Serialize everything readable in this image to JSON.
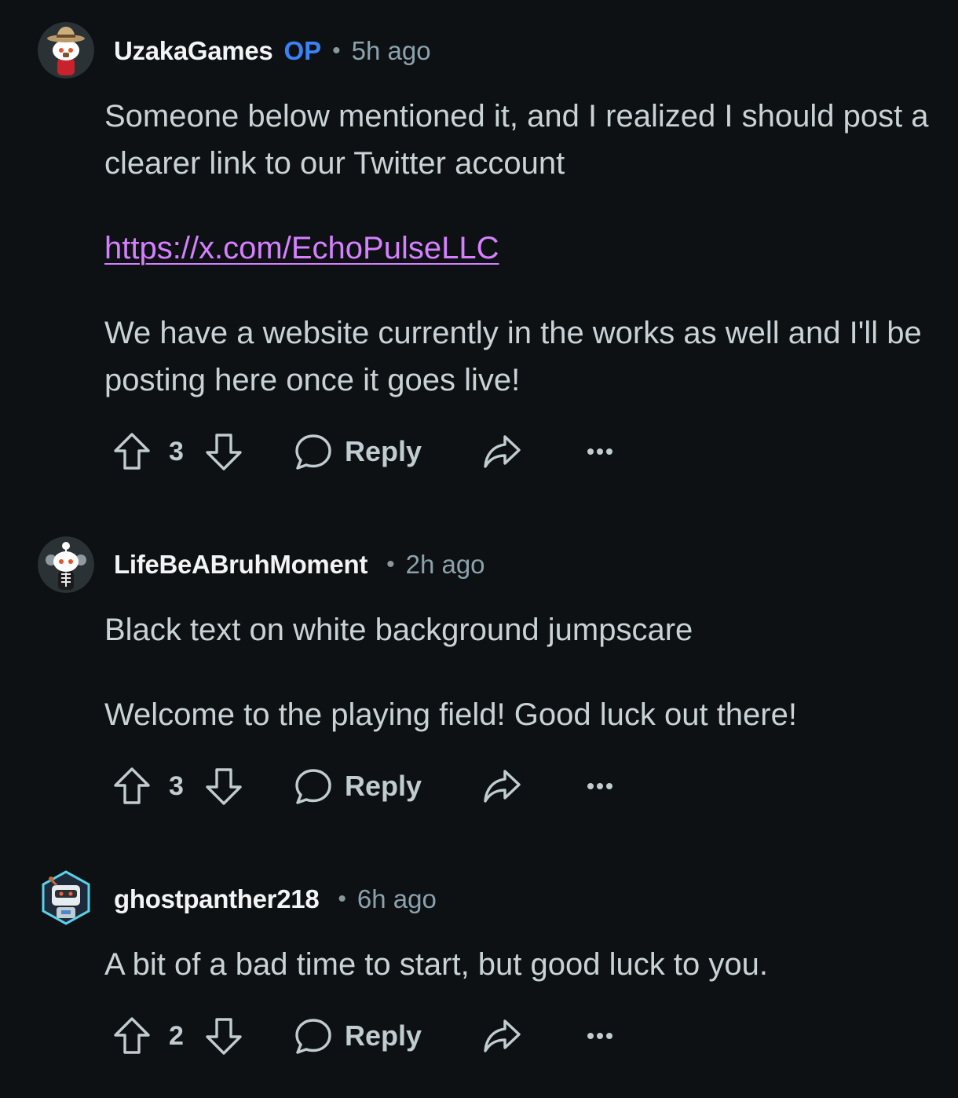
{
  "comments": [
    {
      "username": "UzakaGames",
      "op_badge": "OP",
      "separator": "•",
      "time": "5h ago",
      "paragraphs": [
        "Someone below mentioned it, and I realized I should post a clearer link to our Twitter account",
        "We have a website currently in the works as well and I'll be posting here once it goes live!"
      ],
      "link": "https://x.com/EchoPulseLLC",
      "votes": "3",
      "reply_label": "Reply"
    },
    {
      "username": "LifeBeABruhMoment",
      "separator": "•",
      "time": "2h ago",
      "paragraphs": [
        "Black text on white background jumpscare",
        "Welcome to the playing field! Good luck out there!"
      ],
      "votes": "3",
      "reply_label": "Reply"
    },
    {
      "username": "ghostpanther218",
      "separator": "•",
      "time": "6h ago",
      "paragraphs": [
        "A bit of a bad time to start, but good luck to you."
      ],
      "votes": "2",
      "reply_label": "Reply"
    }
  ],
  "icons": {
    "upvote": "upvote-arrow-icon",
    "downvote": "downvote-arrow-icon",
    "reply": "speech-bubble-icon",
    "share": "share-arrow-icon",
    "more": "ellipsis-icon"
  },
  "colors": {
    "background": "#0e1113",
    "username": "#f2f4f5",
    "op_badge": "#3b82f6",
    "link": "#d580ff",
    "body_text": "#c9d3d6",
    "meta_text": "#8ba2ad"
  }
}
